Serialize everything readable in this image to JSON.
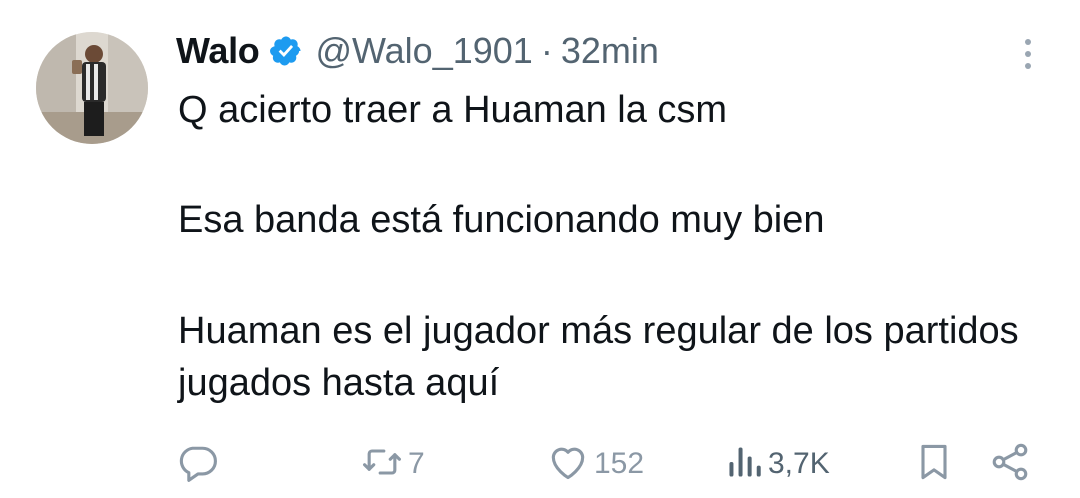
{
  "author": {
    "display_name": "Walo",
    "handle": "@Walo_1901",
    "separator": "·",
    "time": "32min",
    "verified_color": "#1d9bf0"
  },
  "tweet": {
    "paragraphs": [
      "Q acierto traer a Huaman la csm",
      "Esa banda está funcionando muy bien",
      "Huaman es el jugador más regular de los partidos jugados hasta aquí"
    ]
  },
  "actions": {
    "reply_count": "",
    "retweet_count": "7",
    "like_count": "152",
    "views_count": "3,7K"
  },
  "icons": {
    "more": "more-vertical-icon",
    "reply": "reply-icon",
    "retweet": "retweet-icon",
    "like": "heart-icon",
    "views": "views-icon",
    "bookmark": "bookmark-icon",
    "share": "share-icon",
    "verified": "verified-badge-icon"
  },
  "colors": {
    "text": "#0f1419",
    "muted": "#536471",
    "icon": "#8b98a5",
    "verified": "#1d9bf0"
  }
}
